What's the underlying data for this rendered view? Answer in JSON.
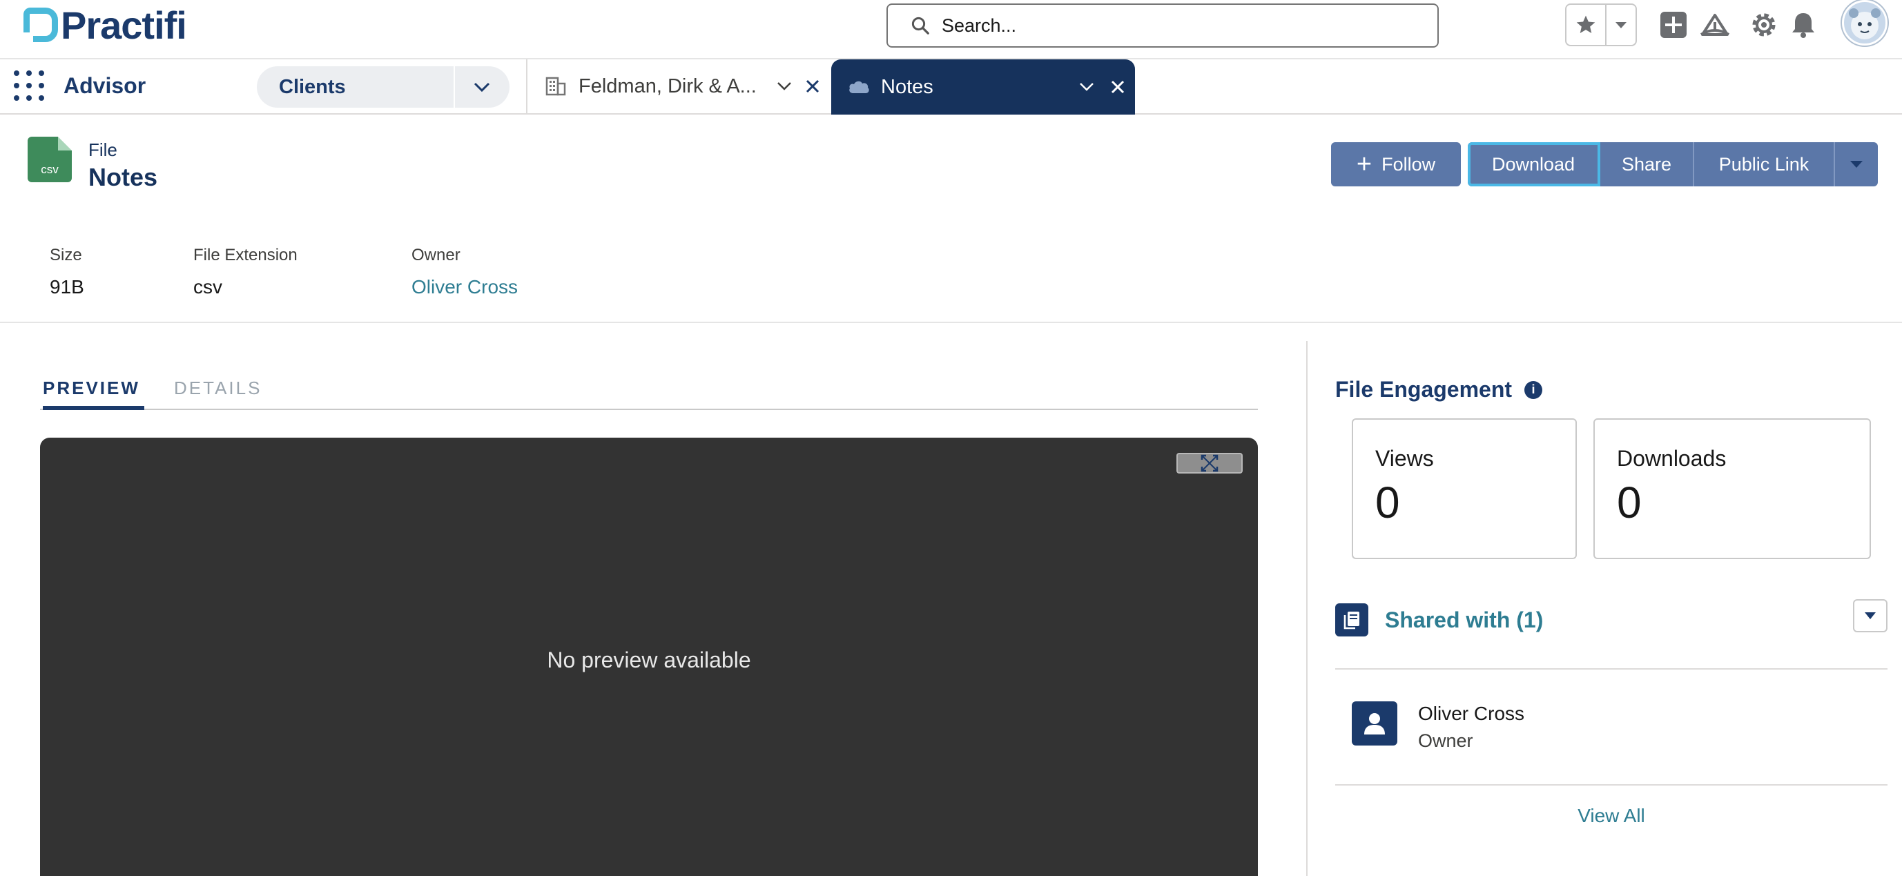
{
  "header": {
    "logo_text": "Practifi",
    "search_placeholder": "Search...",
    "icons": [
      "star-icon",
      "chevron-down-icon",
      "plus-icon",
      "trailhead-icon",
      "gear-icon",
      "bell-icon",
      "avatar"
    ]
  },
  "nav": {
    "app_name": "Advisor",
    "object_selector": "Clients",
    "tabs": [
      {
        "label": "Feldman, Dirk & A...",
        "icon": "building-icon",
        "active": false
      },
      {
        "label": "Notes",
        "icon": "cloud-icon",
        "active": true
      }
    ]
  },
  "record": {
    "type": "File",
    "title": "Notes",
    "icon_ext": "csv",
    "actions": {
      "follow": "Follow",
      "download": "Download",
      "share": "Share",
      "public_link": "Public Link"
    },
    "fields": [
      {
        "label": "Size",
        "value": "91B"
      },
      {
        "label": "File Extension",
        "value": "csv"
      },
      {
        "label": "Owner",
        "value": "Oliver Cross"
      }
    ]
  },
  "content": {
    "tabs": [
      "PREVIEW",
      "DETAILS"
    ],
    "active_tab": "PREVIEW",
    "preview_message": "No preview available"
  },
  "engagement": {
    "title": "File Engagement",
    "views_label": "Views",
    "views_value": "0",
    "downloads_label": "Downloads",
    "downloads_value": "0"
  },
  "shared": {
    "title": "Shared with (1)",
    "people": [
      {
        "name": "Oliver Cross",
        "role": "Owner"
      }
    ],
    "view_all": "View All"
  },
  "colors": {
    "brand_navy": "#1b3a6b",
    "active_tab_bg": "#16325c",
    "button_bg": "#5b77a8",
    "link_teal": "#2e7d92",
    "preview_bg": "#333333",
    "file_icon_green": "#3e8b5b"
  }
}
